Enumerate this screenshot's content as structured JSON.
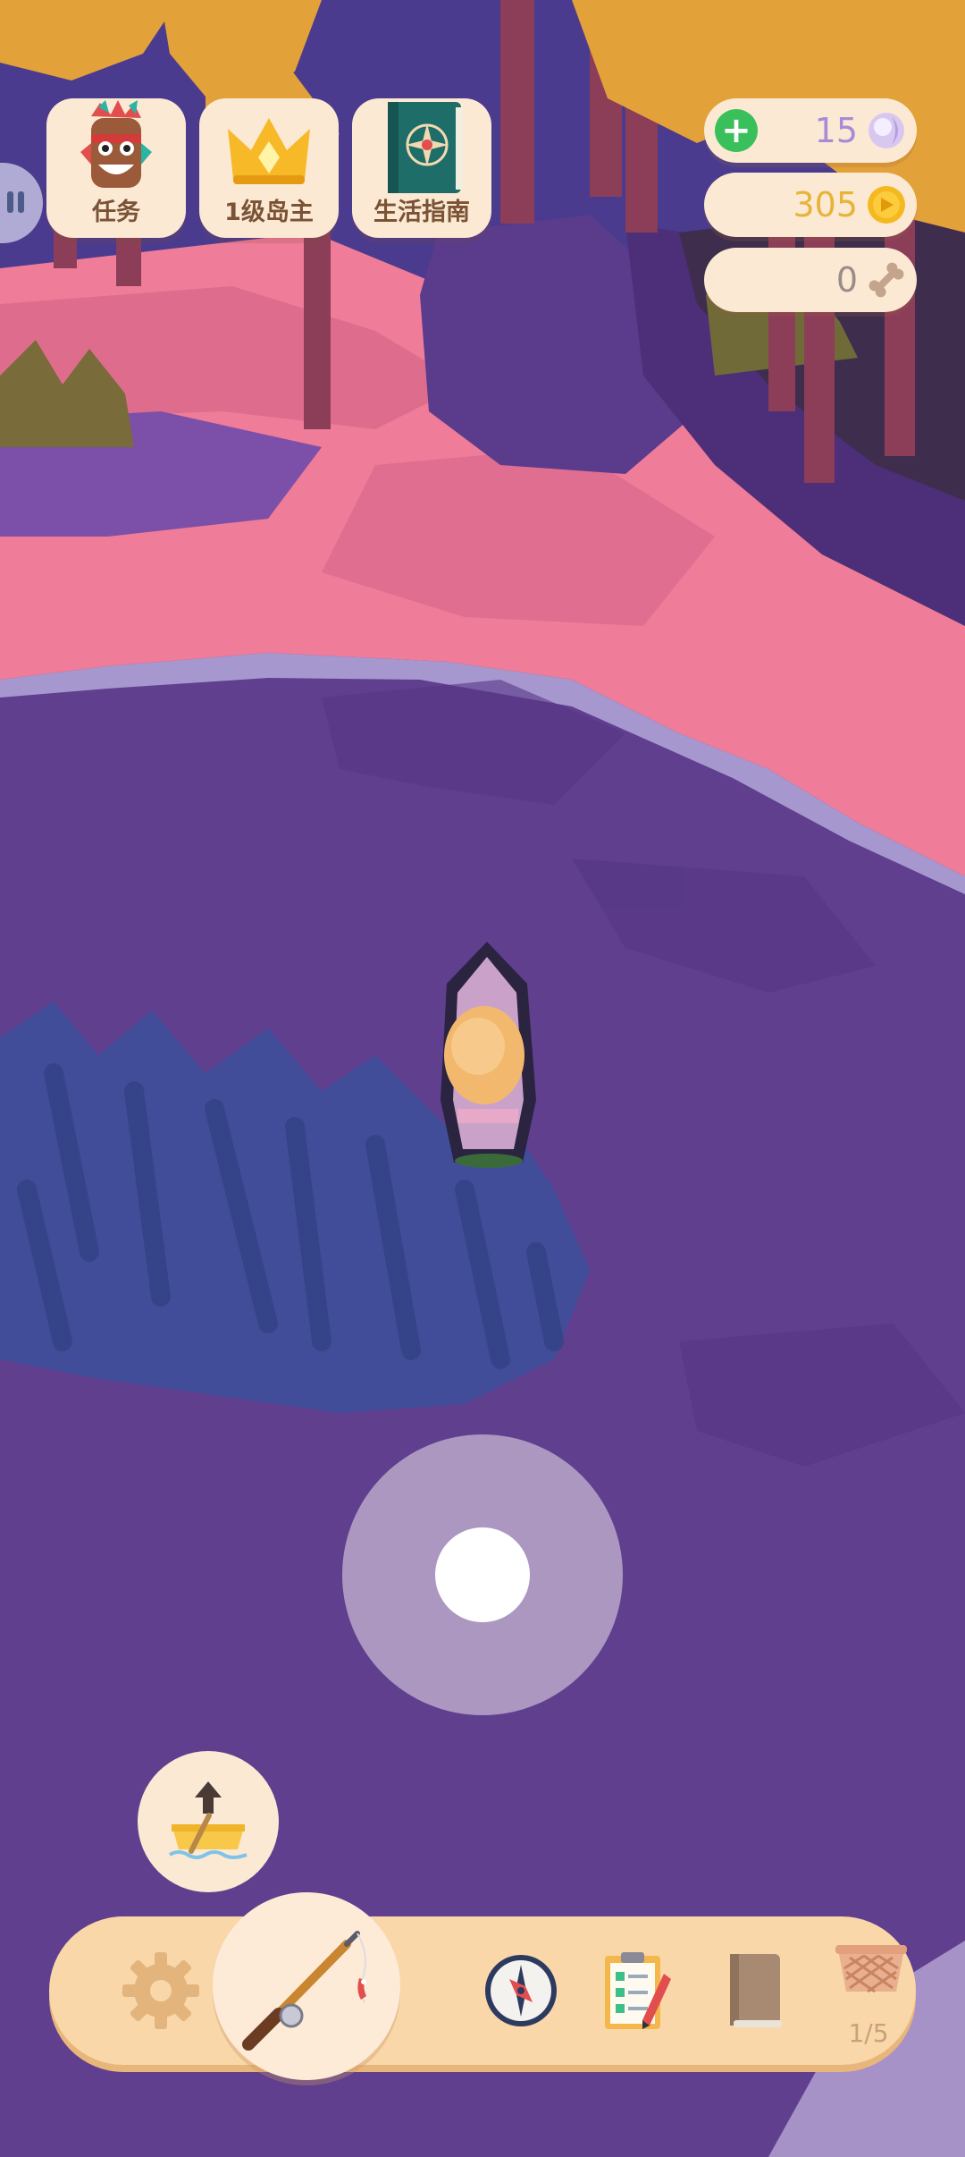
{
  "top_cards": {
    "tasks_label": "任务",
    "level_label": "1级岛主",
    "guide_label": "生活指南"
  },
  "currency": {
    "pearls": "15",
    "coins": "305",
    "bones": "0"
  },
  "toolbar": {
    "basket_count": "1/5"
  },
  "icons": {
    "pause": "pause-icon",
    "tiki_mask": "tiki-mask-icon",
    "crown": "crown-icon",
    "guide_book": "compass-book-icon",
    "plus": "plus-icon",
    "pearl": "pearl-icon",
    "coin": "coin-icon",
    "bone": "bone-icon",
    "launch_boat": "boat-launch-icon",
    "settings": "gear-icon",
    "fishing": "fishing-rod-icon",
    "compass": "compass-icon",
    "checklist": "clipboard-checklist-icon",
    "journal": "book-icon",
    "basket": "basket-icon"
  },
  "colors": {
    "water": "#5e3f8f",
    "sand": "#f07a9a",
    "panel": "#fbe9d3",
    "toolbar": "#f9d7a9",
    "pearl_text": "#a78bd8",
    "coin_text": "#e7b43a",
    "bone_text": "#9a8c88"
  }
}
